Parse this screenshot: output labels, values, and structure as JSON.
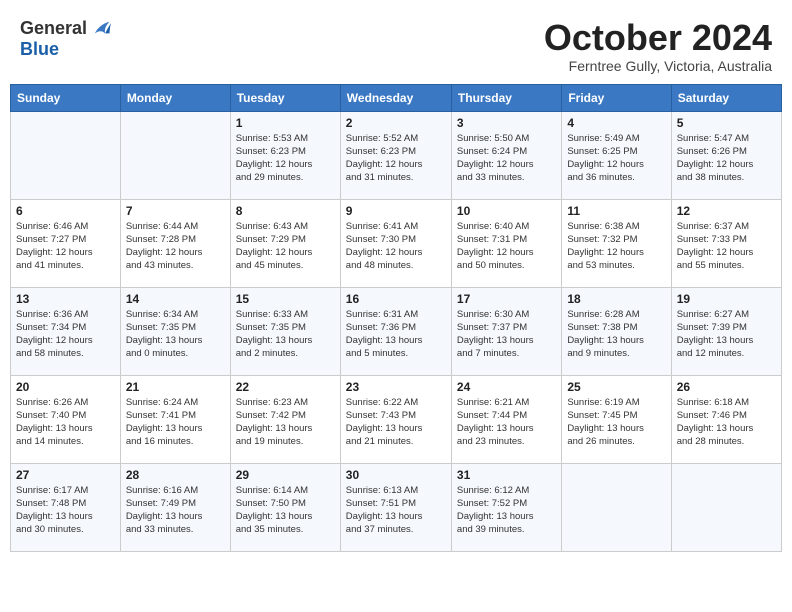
{
  "header": {
    "logo_general": "General",
    "logo_blue": "Blue",
    "month_title": "October 2024",
    "location": "Ferntree Gully, Victoria, Australia"
  },
  "days_of_week": [
    "Sunday",
    "Monday",
    "Tuesday",
    "Wednesday",
    "Thursday",
    "Friday",
    "Saturday"
  ],
  "weeks": [
    [
      {
        "day": "",
        "info": ""
      },
      {
        "day": "",
        "info": ""
      },
      {
        "day": "1",
        "info": "Sunrise: 5:53 AM\nSunset: 6:23 PM\nDaylight: 12 hours\nand 29 minutes."
      },
      {
        "day": "2",
        "info": "Sunrise: 5:52 AM\nSunset: 6:23 PM\nDaylight: 12 hours\nand 31 minutes."
      },
      {
        "day": "3",
        "info": "Sunrise: 5:50 AM\nSunset: 6:24 PM\nDaylight: 12 hours\nand 33 minutes."
      },
      {
        "day": "4",
        "info": "Sunrise: 5:49 AM\nSunset: 6:25 PM\nDaylight: 12 hours\nand 36 minutes."
      },
      {
        "day": "5",
        "info": "Sunrise: 5:47 AM\nSunset: 6:26 PM\nDaylight: 12 hours\nand 38 minutes."
      }
    ],
    [
      {
        "day": "6",
        "info": "Sunrise: 6:46 AM\nSunset: 7:27 PM\nDaylight: 12 hours\nand 41 minutes."
      },
      {
        "day": "7",
        "info": "Sunrise: 6:44 AM\nSunset: 7:28 PM\nDaylight: 12 hours\nand 43 minutes."
      },
      {
        "day": "8",
        "info": "Sunrise: 6:43 AM\nSunset: 7:29 PM\nDaylight: 12 hours\nand 45 minutes."
      },
      {
        "day": "9",
        "info": "Sunrise: 6:41 AM\nSunset: 7:30 PM\nDaylight: 12 hours\nand 48 minutes."
      },
      {
        "day": "10",
        "info": "Sunrise: 6:40 AM\nSunset: 7:31 PM\nDaylight: 12 hours\nand 50 minutes."
      },
      {
        "day": "11",
        "info": "Sunrise: 6:38 AM\nSunset: 7:32 PM\nDaylight: 12 hours\nand 53 minutes."
      },
      {
        "day": "12",
        "info": "Sunrise: 6:37 AM\nSunset: 7:33 PM\nDaylight: 12 hours\nand 55 minutes."
      }
    ],
    [
      {
        "day": "13",
        "info": "Sunrise: 6:36 AM\nSunset: 7:34 PM\nDaylight: 12 hours\nand 58 minutes."
      },
      {
        "day": "14",
        "info": "Sunrise: 6:34 AM\nSunset: 7:35 PM\nDaylight: 13 hours\nand 0 minutes."
      },
      {
        "day": "15",
        "info": "Sunrise: 6:33 AM\nSunset: 7:35 PM\nDaylight: 13 hours\nand 2 minutes."
      },
      {
        "day": "16",
        "info": "Sunrise: 6:31 AM\nSunset: 7:36 PM\nDaylight: 13 hours\nand 5 minutes."
      },
      {
        "day": "17",
        "info": "Sunrise: 6:30 AM\nSunset: 7:37 PM\nDaylight: 13 hours\nand 7 minutes."
      },
      {
        "day": "18",
        "info": "Sunrise: 6:28 AM\nSunset: 7:38 PM\nDaylight: 13 hours\nand 9 minutes."
      },
      {
        "day": "19",
        "info": "Sunrise: 6:27 AM\nSunset: 7:39 PM\nDaylight: 13 hours\nand 12 minutes."
      }
    ],
    [
      {
        "day": "20",
        "info": "Sunrise: 6:26 AM\nSunset: 7:40 PM\nDaylight: 13 hours\nand 14 minutes."
      },
      {
        "day": "21",
        "info": "Sunrise: 6:24 AM\nSunset: 7:41 PM\nDaylight: 13 hours\nand 16 minutes."
      },
      {
        "day": "22",
        "info": "Sunrise: 6:23 AM\nSunset: 7:42 PM\nDaylight: 13 hours\nand 19 minutes."
      },
      {
        "day": "23",
        "info": "Sunrise: 6:22 AM\nSunset: 7:43 PM\nDaylight: 13 hours\nand 21 minutes."
      },
      {
        "day": "24",
        "info": "Sunrise: 6:21 AM\nSunset: 7:44 PM\nDaylight: 13 hours\nand 23 minutes."
      },
      {
        "day": "25",
        "info": "Sunrise: 6:19 AM\nSunset: 7:45 PM\nDaylight: 13 hours\nand 26 minutes."
      },
      {
        "day": "26",
        "info": "Sunrise: 6:18 AM\nSunset: 7:46 PM\nDaylight: 13 hours\nand 28 minutes."
      }
    ],
    [
      {
        "day": "27",
        "info": "Sunrise: 6:17 AM\nSunset: 7:48 PM\nDaylight: 13 hours\nand 30 minutes."
      },
      {
        "day": "28",
        "info": "Sunrise: 6:16 AM\nSunset: 7:49 PM\nDaylight: 13 hours\nand 33 minutes."
      },
      {
        "day": "29",
        "info": "Sunrise: 6:14 AM\nSunset: 7:50 PM\nDaylight: 13 hours\nand 35 minutes."
      },
      {
        "day": "30",
        "info": "Sunrise: 6:13 AM\nSunset: 7:51 PM\nDaylight: 13 hours\nand 37 minutes."
      },
      {
        "day": "31",
        "info": "Sunrise: 6:12 AM\nSunset: 7:52 PM\nDaylight: 13 hours\nand 39 minutes."
      },
      {
        "day": "",
        "info": ""
      },
      {
        "day": "",
        "info": ""
      }
    ]
  ]
}
